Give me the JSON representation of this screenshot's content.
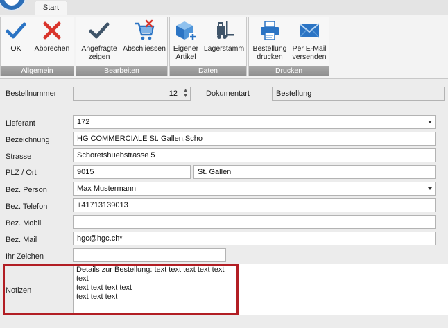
{
  "tabs": {
    "start": "Start"
  },
  "ribbon": {
    "groups": {
      "allgemein": "Allgemein",
      "bearbeiten": "Bearbeiten",
      "daten": "Daten",
      "drucken": "Drucken"
    },
    "buttons": {
      "ok": "OK",
      "abbrechen": "Abbrechen",
      "angefragte_l1": "Angefragte",
      "angefragte_l2": "zeigen",
      "abschliessen": "Abschliessen",
      "eigener_l1": "Eigener",
      "eigener_l2": "Artikel",
      "lagerstamm": "Lagerstamm",
      "bestellung_l1": "Bestellung",
      "bestellung_l2": "drucken",
      "email_l1": "Per E-Mail",
      "email_l2": "versenden"
    }
  },
  "form": {
    "bestellnummer": {
      "label": "Bestellnummer",
      "value": "12"
    },
    "dokumentart": {
      "label": "Dokumentart",
      "value": "Bestellung"
    },
    "lieferant": {
      "label": "Lieferant",
      "value": "172"
    },
    "bezeichnung": {
      "label": "Bezeichnung",
      "value": "HG COMMERCIALE St. Gallen,Scho"
    },
    "strasse": {
      "label": "Strasse",
      "value": "Schoretshuebstrasse 5"
    },
    "plz_ort": {
      "label": "PLZ / Ort",
      "plz": "9015",
      "ort": "St. Gallen"
    },
    "person": {
      "label": "Bez. Person",
      "value": "Max Mustermann"
    },
    "telefon": {
      "label": "Bez. Telefon",
      "value": "+41713139013"
    },
    "mobil": {
      "label": "Bez. Mobil",
      "value": ""
    },
    "mail": {
      "label": "Bez. Mail",
      "value": "hgc@hgc.ch*"
    },
    "zeichen": {
      "label": "Ihr Zeichen",
      "value": ""
    },
    "notizen": {
      "label": "Notizen",
      "value": "Details zur Bestellung: text text text text text\ntext\ntext text text text\ntext text text"
    }
  },
  "colors": {
    "accent_blue": "#2b74c4",
    "cancel_red": "#d9342b",
    "highlight": "#b21e24"
  }
}
